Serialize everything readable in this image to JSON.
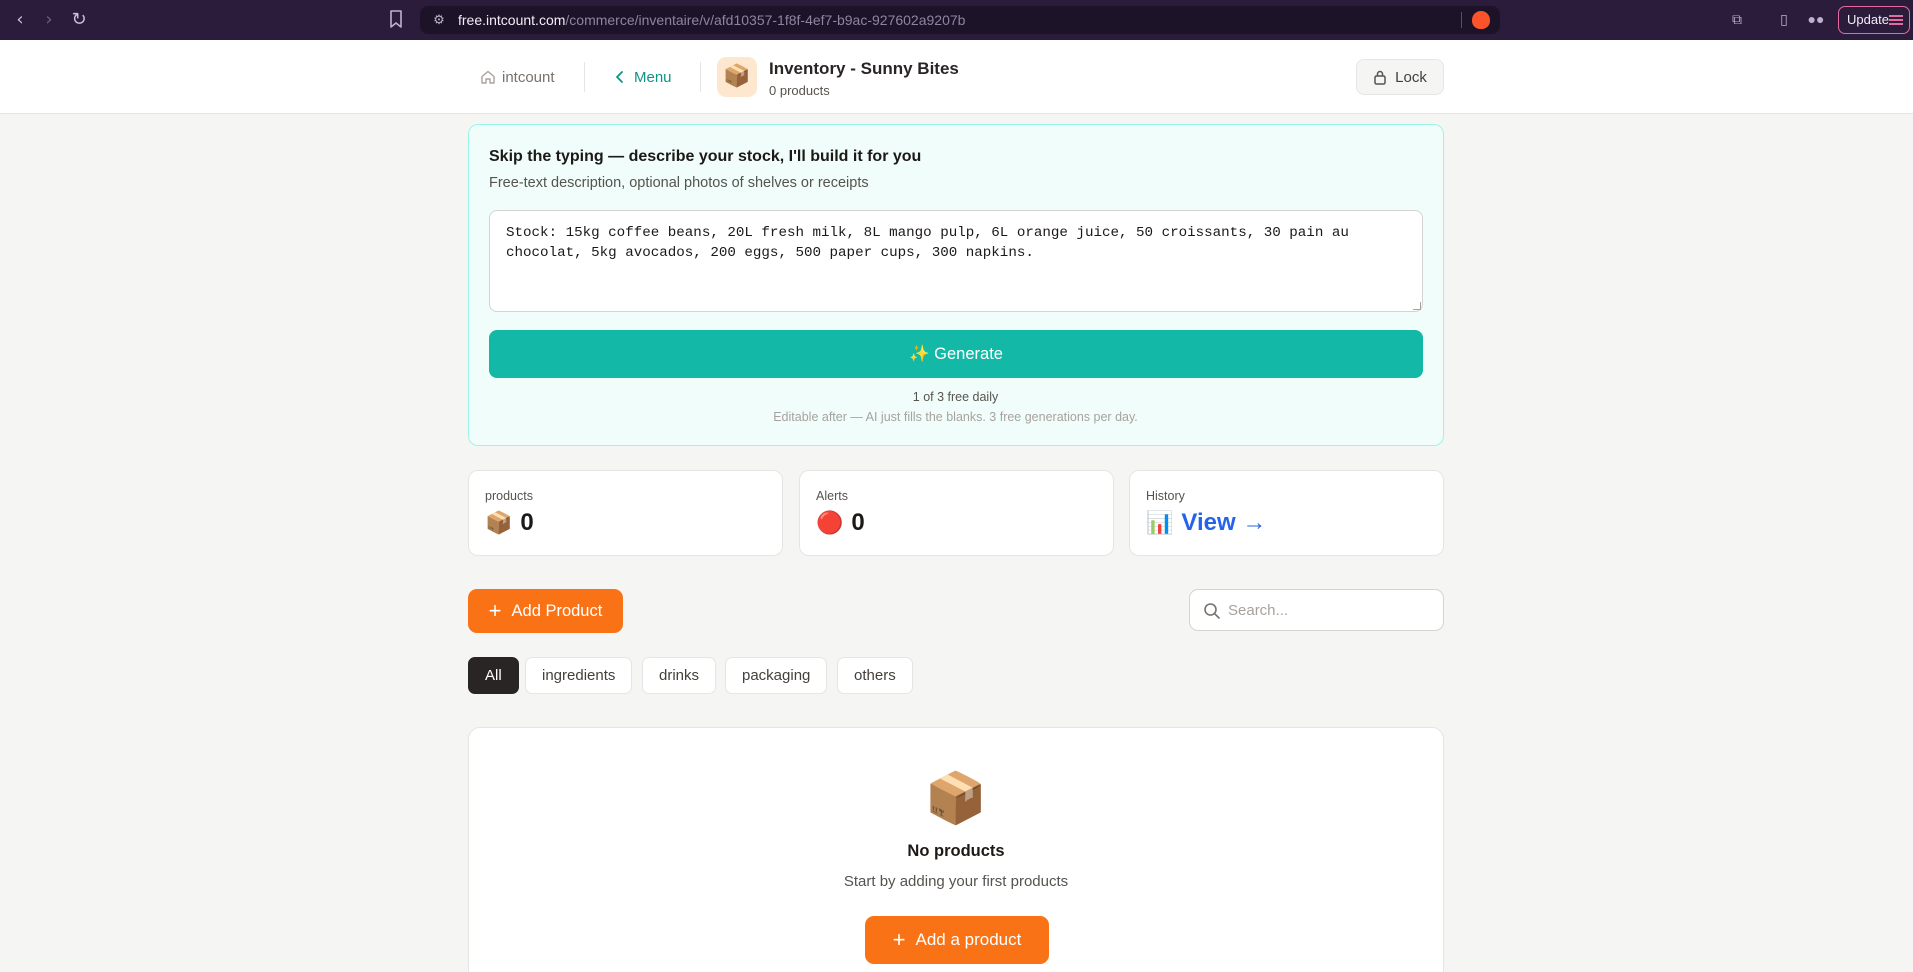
{
  "browser": {
    "url_host": "free.intcount.com",
    "url_path": "/commerce/inventaire/v/afd10357-1f8f-4ef7-b9ac-927602a9207b",
    "update_label": "Update"
  },
  "header": {
    "home_label": "intcount",
    "menu_label": "Menu",
    "brand_icon": "📦",
    "title": "Inventory - Sunny Bites",
    "subtitle": "0 products",
    "lock_label": "Lock"
  },
  "ai": {
    "title": "Skip the typing — describe your stock, I'll build it for you",
    "subtitle": "Free-text description, optional photos of shelves or receipts",
    "input_value": "Stock: 15kg coffee beans, 20L fresh milk, 8L mango pulp, 6L orange juice, 50 croissants, 30 pain au chocolat, 5kg avocados, 200 eggs, 500 paper cups, 300 napkins.",
    "generate_label": "✨ Generate",
    "quota": "1 of 3 free daily",
    "note": "Editable after — AI just fills the blanks. 3 free generations per day."
  },
  "stats": {
    "products": {
      "label": "products",
      "icon": "📦",
      "value": "0"
    },
    "alerts": {
      "label": "Alerts",
      "icon": "🔴",
      "value": "0"
    },
    "history": {
      "label": "History",
      "icon": "📊",
      "value": "View →"
    }
  },
  "actions": {
    "add_label": "Add Product",
    "search_placeholder": "Search..."
  },
  "filters": [
    "All",
    "ingredients",
    "drinks",
    "packaging",
    "others"
  ],
  "active_filter": "All",
  "empty": {
    "icon": "📦",
    "title": "No products",
    "subtitle": "Start by adding your first products",
    "button_label": "Add a product"
  },
  "colors": {
    "accent_teal": "#14b8a6",
    "accent_orange": "#f97316",
    "link_blue": "#2563eb",
    "browser_chrome": "#2a1c3a"
  }
}
